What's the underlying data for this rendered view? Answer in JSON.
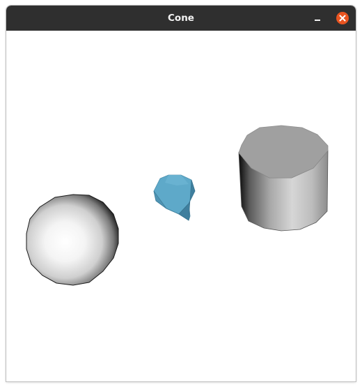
{
  "window": {
    "title": "Cone",
    "controls": {
      "minimize_icon": "minimize-icon",
      "close_icon": "close-icon",
      "close_color": "#e95420"
    }
  },
  "scene": {
    "background": "#ffffff",
    "objects": [
      {
        "name": "sphere",
        "color": "#ffffff"
      },
      {
        "name": "cone",
        "color": "#5aa7c8"
      },
      {
        "name": "cylinder",
        "color": "#a8a8a8"
      }
    ]
  }
}
